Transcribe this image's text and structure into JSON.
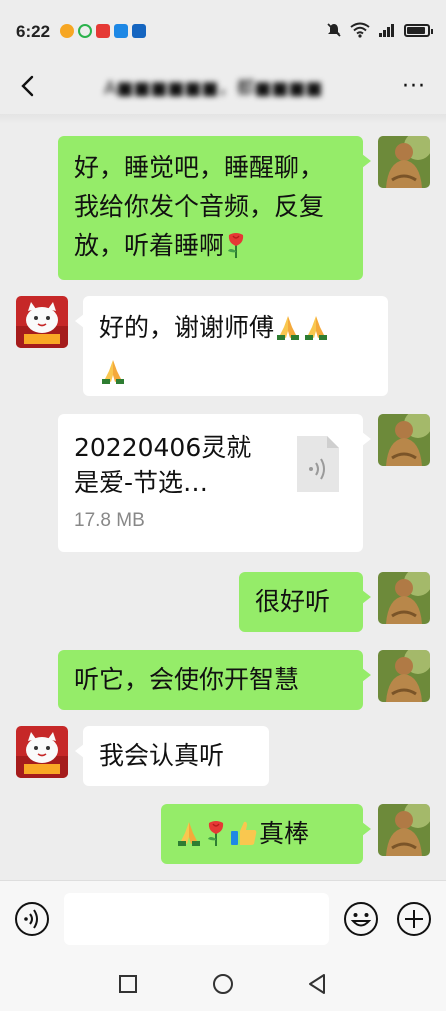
{
  "status_bar": {
    "time": "6:22",
    "battery_level": 0.9
  },
  "header": {
    "title": "A■■■■■■，都■■■■",
    "back_icon": "chevron-left-icon",
    "more_label": "···"
  },
  "messages": [
    {
      "side": "right",
      "type": "text",
      "text": "好，睡觉吧，睡醒聊，我给你发个音频，反复放，听着睡啊",
      "emoji": [
        "rose"
      ]
    },
    {
      "side": "left",
      "type": "text",
      "text": "好的，谢谢师傅",
      "emoji": [
        "folded-hands",
        "folded-hands",
        "folded-hands"
      ]
    },
    {
      "side": "right",
      "type": "file",
      "file_name_line1": "20220406灵就",
      "file_name_line2": "是爱-节选…",
      "file_size": "17.8 MB",
      "file_icon": "audio-file-icon"
    },
    {
      "side": "right",
      "type": "text",
      "text": "很好听"
    },
    {
      "side": "right",
      "type": "text",
      "text": "听它，会使你开智慧"
    },
    {
      "side": "left",
      "type": "text",
      "text": "我会认真听"
    },
    {
      "side": "right",
      "type": "text",
      "text": "真棒",
      "emoji_prefix": [
        "folded-hands",
        "rose",
        "thumbs-up"
      ]
    }
  ],
  "input_bar": {
    "placeholder": "",
    "voice_icon": "voice-icon",
    "emoji_icon": "emoji-icon",
    "plus_icon": "plus-icon"
  },
  "nav_bar": {
    "icons": [
      "recents-square-icon",
      "home-circle-icon",
      "back-triangle-icon"
    ]
  },
  "colors": {
    "background": "#ededed",
    "sent_bubble": "#95ec69",
    "received_bubble": "#ffffff"
  }
}
